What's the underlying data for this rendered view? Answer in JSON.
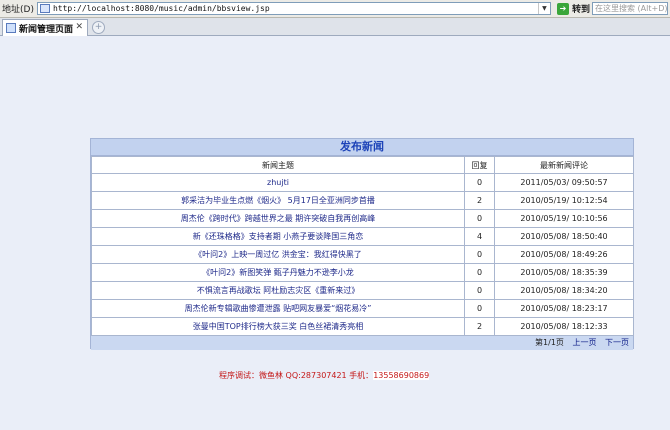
{
  "browser": {
    "address_label": "地址(D)",
    "url": "http://localhost:8080/music/admin/bbsview.jsp",
    "go_label": "转到",
    "search_placeholder": "在这里搜索 (Alt+D)",
    "tab_title": "新闻管理页面"
  },
  "panel": {
    "title": "发布新闻",
    "columns": [
      "新闻主题",
      "回复",
      "最新新闻评论"
    ],
    "rows": [
      {
        "subject": "zhujti",
        "replies": "0",
        "latest": "2011/05/03/ 09:50:57"
      },
      {
        "subject": "郭采洁为毕业生点燃《烟火》 5月17日全亚洲同步首播",
        "replies": "2",
        "latest": "2010/05/19/ 10:12:54"
      },
      {
        "subject": "周杰伦《跨时代》跨越世界之最 期许突破自我再创高峰",
        "replies": "0",
        "latest": "2010/05/19/ 10:10:56"
      },
      {
        "subject": "新《还珠格格》支持者期 小燕子要谈降国三角恋",
        "replies": "4",
        "latest": "2010/05/08/ 18:50:40"
      },
      {
        "subject": "《叶问2》上映一周过亿 洪金宝：我红得快黑了",
        "replies": "0",
        "latest": "2010/05/08/ 18:49:26"
      },
      {
        "subject": "《叶问2》新图笑弹 甄子丹魅力不逊李小龙",
        "replies": "0",
        "latest": "2010/05/08/ 18:35:39"
      },
      {
        "subject": "不惧流言再战歌坛 阿杜励志灾区《重新来过》",
        "replies": "0",
        "latest": "2010/05/08/ 18:34:20"
      },
      {
        "subject": "周杰伦新专辑歌曲惨遭泄露 贴吧网友暴爱“烟花易冷”",
        "replies": "0",
        "latest": "2010/05/08/ 18:23:17"
      },
      {
        "subject": "张曼中国TOP排行榜大获三奖 白色丝裙清秀亮相",
        "replies": "2",
        "latest": "2010/05/08/ 18:12:33"
      }
    ],
    "pager": {
      "page_info": "第1/1页",
      "prev": "上一页",
      "next": "下一页"
    }
  },
  "footer": {
    "credit": "程序调试：微鱼林 QQ:287307421 手机：",
    "phone": "13558690869"
  }
}
